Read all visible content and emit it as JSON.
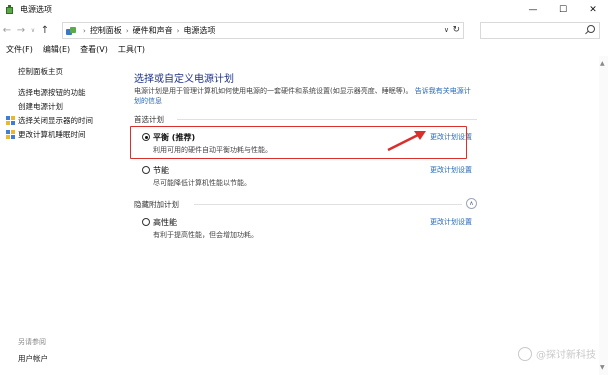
{
  "window": {
    "title": "电源选项",
    "controls": {
      "minimize": "—",
      "maximize": "☐",
      "close": "✕"
    }
  },
  "address": {
    "breadcrumbs": [
      "控制面板",
      "硬件和声音",
      "电源选项"
    ],
    "search_placeholder": ""
  },
  "menu": [
    "文件(F)",
    "编辑(E)",
    "查看(V)",
    "工具(T)"
  ],
  "sidebar": {
    "home": "控制面板主页",
    "links": [
      "选择电源按钮的功能",
      "创建电源计划",
      "选择关闭显示器的时间",
      "更改计算机睡眠时间"
    ],
    "see_also": "另请参阅",
    "user_accounts": "用户帐户"
  },
  "main": {
    "heading": "选择或自定义电源计划",
    "desc_line1": "电源计划是用于管理计算机如何使用电源的一套硬件和系统设置(如显示器亮度、睡眠等)。",
    "desc_link1": "告诉我有关电源计",
    "desc_link2": "划的信息",
    "preferred_header": "首选计划",
    "hidden_header": "隐藏附加计划",
    "change_link": "更改计划设置",
    "plans": [
      {
        "name": "平衡 (推荐)",
        "desc": "利用可用的硬件自动平衡功耗与性能。",
        "selected": true
      },
      {
        "name": "节能",
        "desc": "尽可能降低计算机性能以节能。",
        "selected": false
      },
      {
        "name": "高性能",
        "desc": "有利于提高性能，但会增加功耗。",
        "selected": false
      }
    ]
  },
  "watermark": "@探讨新科技",
  "colors": {
    "accent": "#1e3287",
    "link": "#2667b3",
    "annotation": "#d9302c"
  }
}
